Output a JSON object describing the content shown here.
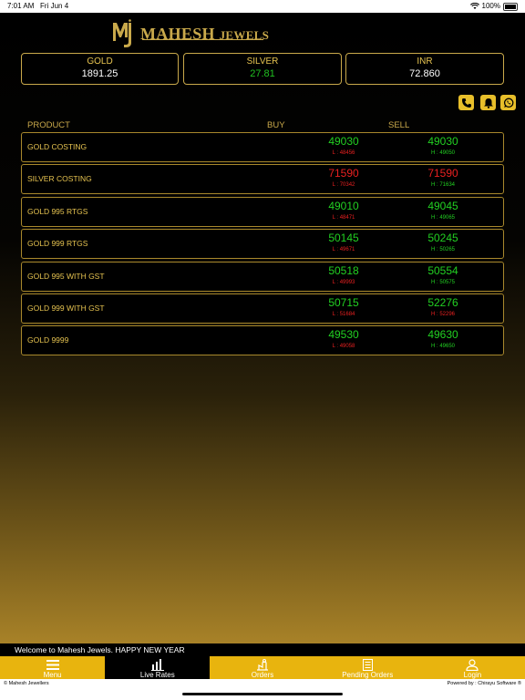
{
  "status_bar": {
    "time": "7:01 AM",
    "date": "Fri Jun 4",
    "battery": "100%"
  },
  "brand": {
    "name_main": "MAHESH",
    "name_small": "JEWELS"
  },
  "colors": {
    "gold": "#c9a94b",
    "accent": "#e8b40e",
    "green": "#22d022",
    "red": "#e82020"
  },
  "rates": [
    {
      "title": "GOLD",
      "value": "1891.25"
    },
    {
      "title": "SILVER",
      "value": "27.81"
    },
    {
      "title": "INR",
      "value": "72.860"
    }
  ],
  "actions": {
    "phone_icon": "phone-icon",
    "bell_icon": "bell-icon",
    "whatsapp_icon": "whatsapp-icon"
  },
  "table_header": {
    "product": "PRODUCT",
    "buy": "BUY",
    "sell": "SELL"
  },
  "products": [
    {
      "name": "GOLD COSTING",
      "buy": "49030",
      "buy_sub": "L : 48456",
      "buy_color": "green",
      "sell": "49030",
      "sell_sub": "H : 49050",
      "sell_color": "green"
    },
    {
      "name": "SILVER COSTING",
      "buy": "71590",
      "buy_sub": "L : 70342",
      "buy_color": "red",
      "sell": "71590",
      "sell_sub": "H : 71634",
      "sell_color": "red"
    },
    {
      "name": "GOLD 995 RTGS",
      "buy": "49010",
      "buy_sub": "L : 48471",
      "buy_color": "green",
      "sell": "49045",
      "sell_sub": "H : 49065",
      "sell_color": "green"
    },
    {
      "name": "GOLD 999 RTGS",
      "buy": "50145",
      "buy_sub": "L : 49671",
      "buy_color": "green",
      "sell": "50245",
      "sell_sub": "H : 50265",
      "sell_color": "green"
    },
    {
      "name": "GOLD 995 WITH GST",
      "buy": "50518",
      "buy_sub": "L : 49993",
      "buy_color": "green",
      "sell": "50554",
      "sell_sub": "H : 50575",
      "sell_color": "green"
    },
    {
      "name": "GOLD 999 WITH GST",
      "buy": "50715",
      "buy_sub": "L : 51684",
      "buy_color": "green",
      "sell": "52276",
      "sell_sub": "H : 52296",
      "sell_color": "green"
    },
    {
      "name": "GOLD 9999",
      "buy": "49530",
      "buy_sub": "L : 49058",
      "buy_color": "green",
      "sell": "49630",
      "sell_sub": "H : 49650",
      "sell_color": "green"
    }
  ],
  "ticker": "Welcome to Mahesh Jewels. HAPPY NEW YEAR",
  "tabs": [
    {
      "label": "Menu",
      "icon": "menu-icon"
    },
    {
      "label": "Live Rates",
      "icon": "chart-icon"
    },
    {
      "label": "Orders",
      "icon": "orders-icon"
    },
    {
      "label": "Pending Orders",
      "icon": "document-icon"
    },
    {
      "label": "Login",
      "icon": "login-icon"
    }
  ],
  "footer": {
    "left": "© Mahesh Jewellers",
    "right": "Powered by : Chirayu Software ®"
  }
}
